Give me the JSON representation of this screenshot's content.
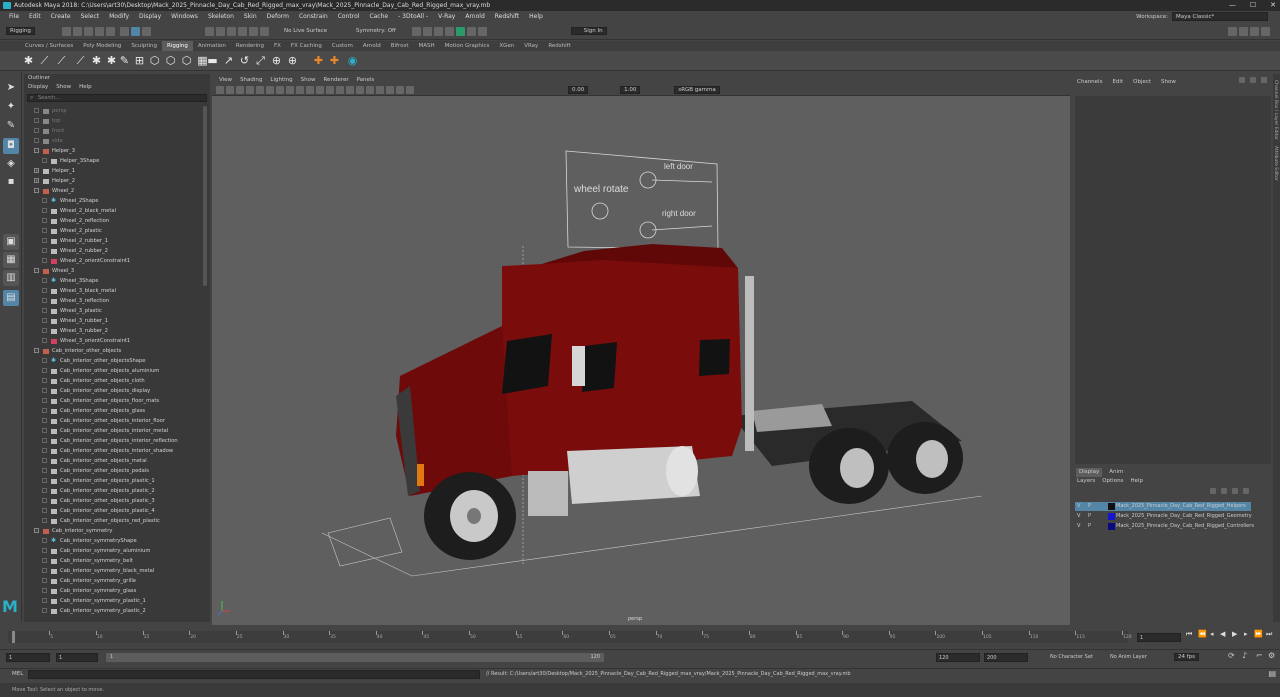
{
  "titlebar": {
    "text": "Autodesk Maya 2018: C:\\Users\\art30\\Desktop\\Mack_2025_Pinnacle_Day_Cab_Red_Rigged_max_vray\\Mack_2025_Pinnacle_Day_Cab_Red_Rigged_max_vray.mb",
    "minimize": "—",
    "maximize": "☐",
    "close": "✕"
  },
  "menubar": [
    "File",
    "Edit",
    "Create",
    "Select",
    "Modify",
    "Display",
    "Windows",
    "Skeleton",
    "Skin",
    "Deform",
    "Constrain",
    "Control",
    "Cache",
    "- 3DtoAll -",
    "V-Ray",
    "Arnold",
    "Redshift",
    "Help"
  ],
  "workspace": {
    "label": "Workspace:",
    "value": "Maya Classic*"
  },
  "status": {
    "mode": "Rigging",
    "live_surface": "No Live Surface",
    "symmetry": "Symmetry: Off",
    "sign_in": "Sign In"
  },
  "shelf_tabs": [
    "Curves / Surfaces",
    "Poly Modeling",
    "Sculpting",
    "Rigging",
    "Animation",
    "Rendering",
    "FX",
    "FX Caching",
    "Custom",
    "Arnold",
    "Bifrost",
    "MASH",
    "Motion Graphics",
    "XGen",
    "VRay",
    "Redshift"
  ],
  "shelf_active": "Rigging",
  "outliner": {
    "title": "Outliner",
    "menu": [
      "Display",
      "Show",
      "Help"
    ],
    "search_placeholder": "Search...",
    "rows": [
      {
        "label": "persp",
        "depth": 0,
        "type": "cam",
        "dim": true
      },
      {
        "label": "top",
        "depth": 0,
        "type": "cam",
        "dim": true
      },
      {
        "label": "front",
        "depth": 0,
        "type": "cam",
        "dim": true
      },
      {
        "label": "side",
        "depth": 0,
        "type": "cam",
        "dim": true
      },
      {
        "label": "Helper_3",
        "depth": 0,
        "type": "group",
        "exp": "-"
      },
      {
        "label": "Helper_3Shape",
        "depth": 1,
        "type": "mesh"
      },
      {
        "label": "Helper_1",
        "depth": 0,
        "type": "mesh",
        "exp": "+"
      },
      {
        "label": "Helper_2",
        "depth": 0,
        "type": "mesh",
        "exp": "+"
      },
      {
        "label": "Wheel_2",
        "depth": 0,
        "type": "group",
        "exp": "-"
      },
      {
        "label": "Wheel_2Shape",
        "depth": 1,
        "type": "shape"
      },
      {
        "label": "Wheel_2_black_metal",
        "depth": 1,
        "type": "mesh"
      },
      {
        "label": "Wheel_2_reflection",
        "depth": 1,
        "type": "mesh"
      },
      {
        "label": "Wheel_2_plastic",
        "depth": 1,
        "type": "mesh"
      },
      {
        "label": "Wheel_2_rubber_1",
        "depth": 1,
        "type": "mesh"
      },
      {
        "label": "Wheel_2_rubber_2",
        "depth": 1,
        "type": "mesh"
      },
      {
        "label": "Wheel_2_orientConstraint1",
        "depth": 1,
        "type": "constraint"
      },
      {
        "label": "Wheel_3",
        "depth": 0,
        "type": "group",
        "exp": "-"
      },
      {
        "label": "Wheel_3Shape",
        "depth": 1,
        "type": "shape"
      },
      {
        "label": "Wheel_3_black_metal",
        "depth": 1,
        "type": "mesh"
      },
      {
        "label": "Wheel_3_reflection",
        "depth": 1,
        "type": "mesh"
      },
      {
        "label": "Wheel_3_plastic",
        "depth": 1,
        "type": "mesh"
      },
      {
        "label": "Wheel_3_rubber_1",
        "depth": 1,
        "type": "mesh"
      },
      {
        "label": "Wheel_3_rubber_2",
        "depth": 1,
        "type": "mesh"
      },
      {
        "label": "Wheel_3_orientConstraint1",
        "depth": 1,
        "type": "constraint"
      },
      {
        "label": "Cab_interior_other_objects",
        "depth": 0,
        "type": "group",
        "exp": "-"
      },
      {
        "label": "Cab_interior_other_objectsShape",
        "depth": 1,
        "type": "shape"
      },
      {
        "label": "Cab_interior_other_objects_aluminium",
        "depth": 1,
        "type": "mesh"
      },
      {
        "label": "Cab_interior_other_objects_cloth",
        "depth": 1,
        "type": "mesh"
      },
      {
        "label": "Cab_interior_other_objects_display",
        "depth": 1,
        "type": "mesh"
      },
      {
        "label": "Cab_interior_other_objects_floor_mats",
        "depth": 1,
        "type": "mesh"
      },
      {
        "label": "Cab_interior_other_objects_glass",
        "depth": 1,
        "type": "mesh"
      },
      {
        "label": "Cab_interior_other_objects_interior_floor",
        "depth": 1,
        "type": "mesh"
      },
      {
        "label": "Cab_interior_other_objects_interior_metal",
        "depth": 1,
        "type": "mesh"
      },
      {
        "label": "Cab_interior_other_objects_interior_reflection",
        "depth": 1,
        "type": "mesh"
      },
      {
        "label": "Cab_interior_other_objects_interior_shadow",
        "depth": 1,
        "type": "mesh"
      },
      {
        "label": "Cab_interior_other_objects_metal",
        "depth": 1,
        "type": "mesh"
      },
      {
        "label": "Cab_interior_other_objects_pedals",
        "depth": 1,
        "type": "mesh"
      },
      {
        "label": "Cab_interior_other_objects_plastic_1",
        "depth": 1,
        "type": "mesh"
      },
      {
        "label": "Cab_interior_other_objects_plastic_2",
        "depth": 1,
        "type": "mesh"
      },
      {
        "label": "Cab_interior_other_objects_plastic_3",
        "depth": 1,
        "type": "mesh"
      },
      {
        "label": "Cab_interior_other_objects_plastic_4",
        "depth": 1,
        "type": "mesh"
      },
      {
        "label": "Cab_interior_other_objects_red_plastic",
        "depth": 1,
        "type": "mesh"
      },
      {
        "label": "Cab_interior_symmetry",
        "depth": 0,
        "type": "group",
        "exp": "-"
      },
      {
        "label": "Cab_interior_symmetryShape",
        "depth": 1,
        "type": "shape"
      },
      {
        "label": "Cab_interior_symmetry_aluminium",
        "depth": 1,
        "type": "mesh"
      },
      {
        "label": "Cab_interior_symmetry_belt",
        "depth": 1,
        "type": "mesh"
      },
      {
        "label": "Cab_interior_symmetry_black_metal",
        "depth": 1,
        "type": "mesh"
      },
      {
        "label": "Cab_interior_symmetry_grille",
        "depth": 1,
        "type": "mesh"
      },
      {
        "label": "Cab_interior_symmetry_glass",
        "depth": 1,
        "type": "mesh"
      },
      {
        "label": "Cab_interior_symmetry_plastic_1",
        "depth": 1,
        "type": "mesh"
      },
      {
        "label": "Cab_interior_symmetry_plastic_2",
        "depth": 1,
        "type": "mesh"
      }
    ]
  },
  "viewport": {
    "menu": [
      "View",
      "Shading",
      "Lighting",
      "Show",
      "Renderer",
      "Panels"
    ],
    "exposure": "0.00",
    "gamma": "1.00",
    "color_space": "sRGB gamma",
    "camera_label": "persp",
    "control_panel": {
      "wheel_rotate": "wheel rotate",
      "left_door": "left door",
      "right_door": "right door"
    }
  },
  "channelbox": {
    "menu": [
      "Channels",
      "Edit",
      "Object",
      "Show"
    ]
  },
  "sidetabs": [
    "Channel Box / Layer Editor",
    "Attribute Editor"
  ],
  "layers": {
    "tabs": [
      "Display",
      "Anim"
    ],
    "active_tab": "Display",
    "menu": [
      "Layers",
      "Options",
      "Help"
    ],
    "rows": [
      {
        "v": "V",
        "p": "P",
        "name": "Mack_2025_Pinnacle_Day_Cab_Red_Rigged_Helpers",
        "color": "#111111",
        "selected": true
      },
      {
        "v": "V",
        "p": "P",
        "name": "Mack_2025_Pinnacle_Day_Cab_Red_Rigged_Geometry",
        "color": "#1515d0",
        "selected": false
      },
      {
        "v": "V",
        "p": "P",
        "name": "Mack_2025_Pinnacle_Day_Cab_Red_Rigged_Controllers",
        "color": "#0a0a80",
        "selected": false
      }
    ]
  },
  "timeslider": {
    "ticks": [
      "1",
      "5",
      "10",
      "15",
      "20",
      "25",
      "30",
      "35",
      "40",
      "45",
      "50",
      "55",
      "60",
      "65",
      "70",
      "75",
      "80",
      "85",
      "90",
      "95",
      "100",
      "105",
      "110",
      "115",
      "120"
    ],
    "current_frame": "1"
  },
  "range": {
    "start": "1",
    "start2": "1",
    "range_start": "1",
    "range_end": "120",
    "end": "120",
    "end2": "200",
    "character_set": "No Character Set",
    "anim_layer": "No Anim Layer",
    "fps": "24 fps"
  },
  "cmdline": {
    "label": "MEL",
    "result": "// Result: C:/Users/art30/Desktop/Mack_2025_Pinnacle_Day_Cab_Red_Rigged_max_vray/Mack_2025_Pinnacle_Day_Cab_Red_Rigged_max_vray.mb"
  },
  "helpline": "Move Tool: Select an object to move.",
  "colors": {
    "truck_red": "#7a0c0c",
    "viewport_bg": "#5f5f5f",
    "selection": "#5285a6"
  }
}
